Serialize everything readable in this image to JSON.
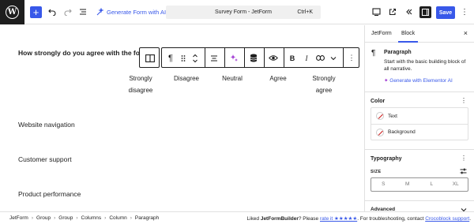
{
  "topbar": {
    "generate_form_label": "Generate Form with AI",
    "document_title": "Survey Form - JetForm",
    "shortcut": "Ctrl+K",
    "save_label": "Save",
    "add_icon": "plus-icon",
    "accent_color": "#3858e9"
  },
  "canvas": {
    "question": "How strongly do you agree with the fo",
    "scale": [
      {
        "line1": "Strongly",
        "line2": "disagree"
      },
      {
        "line1": "Disagree",
        "line2": ""
      },
      {
        "line1": "Neutral",
        "line2": ""
      },
      {
        "line1": "Agree",
        "line2": ""
      },
      {
        "line1": "Strongly",
        "line2": "agree"
      }
    ],
    "rows": [
      "Website navigation",
      "Customer support",
      "Product performance"
    ]
  },
  "block_toolbar": {
    "bold": "B",
    "italic": "I",
    "pilcrow": "¶"
  },
  "sidebar": {
    "tabs": [
      "JetForm",
      "Block"
    ],
    "active_tab": "Block",
    "close": "×",
    "block_name": "Paragraph",
    "block_description": "Start with the basic building block of all narrative.",
    "generate_elementor": "Generate with Elementor AI",
    "color_title": "Color",
    "color_items": [
      "Text",
      "Background"
    ],
    "typography_title": "Typography",
    "size_label": "SIZE",
    "sizes": [
      "S",
      "M",
      "L",
      "XL"
    ],
    "advanced_title": "Advanced"
  },
  "footer": {
    "breadcrumbs": [
      "JetForm",
      "Group",
      "Group",
      "Columns",
      "Column",
      "Paragraph"
    ],
    "note_prefix": "Liked ",
    "note_brand": "JetFormBuilder",
    "note_mid": "? Please ",
    "note_rate": "rate it ★★★★★",
    "note_after": ". For troubleshooting, contact ",
    "note_support": "Crocoblock support",
    "note_end": "."
  }
}
